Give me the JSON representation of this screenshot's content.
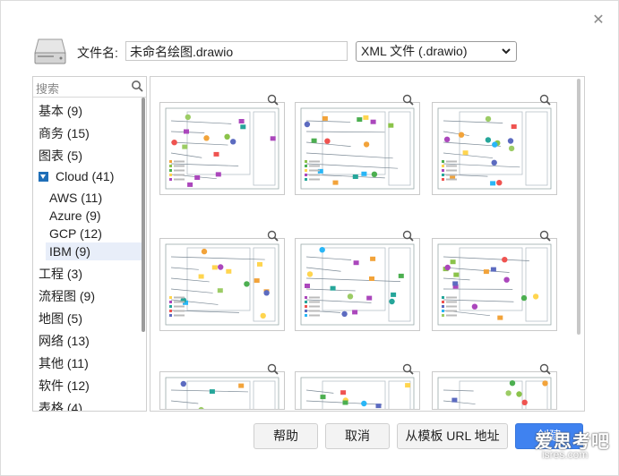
{
  "dialog": {
    "close_icon": "close-x"
  },
  "filename": {
    "label": "文件名:",
    "value": "未命名绘图.drawio"
  },
  "format": {
    "selected": "XML 文件 (.drawio)"
  },
  "search": {
    "placeholder": "搜索"
  },
  "categories": [
    {
      "label": "基本 (9)"
    },
    {
      "label": "商务 (15)"
    },
    {
      "label": "图表 (5)"
    },
    {
      "label": "Cloud (41)",
      "expanded": true
    },
    {
      "label": "AWS (11)"
    },
    {
      "label": "Azure (9)"
    },
    {
      "label": "GCP (12)"
    },
    {
      "label": "IBM (9)",
      "selected": true
    },
    {
      "label": "工程 (3)"
    },
    {
      "label": "流程图 (9)"
    },
    {
      "label": "地图 (5)"
    },
    {
      "label": "网络 (13)"
    },
    {
      "label": "其他 (11)"
    },
    {
      "label": "软件 (12)"
    },
    {
      "label": "表格 (4)"
    }
  ],
  "buttons": {
    "help": "帮助",
    "cancel": "取消",
    "from_url": "从模板 URL 地址",
    "create": "创建"
  },
  "watermark": {
    "text": "爱思考吧",
    "sub": "isres.com"
  },
  "colors": {
    "accent": "#3f82f0",
    "selected_bg": "#e8eef9",
    "tree_icon": "#1f6fb8"
  }
}
